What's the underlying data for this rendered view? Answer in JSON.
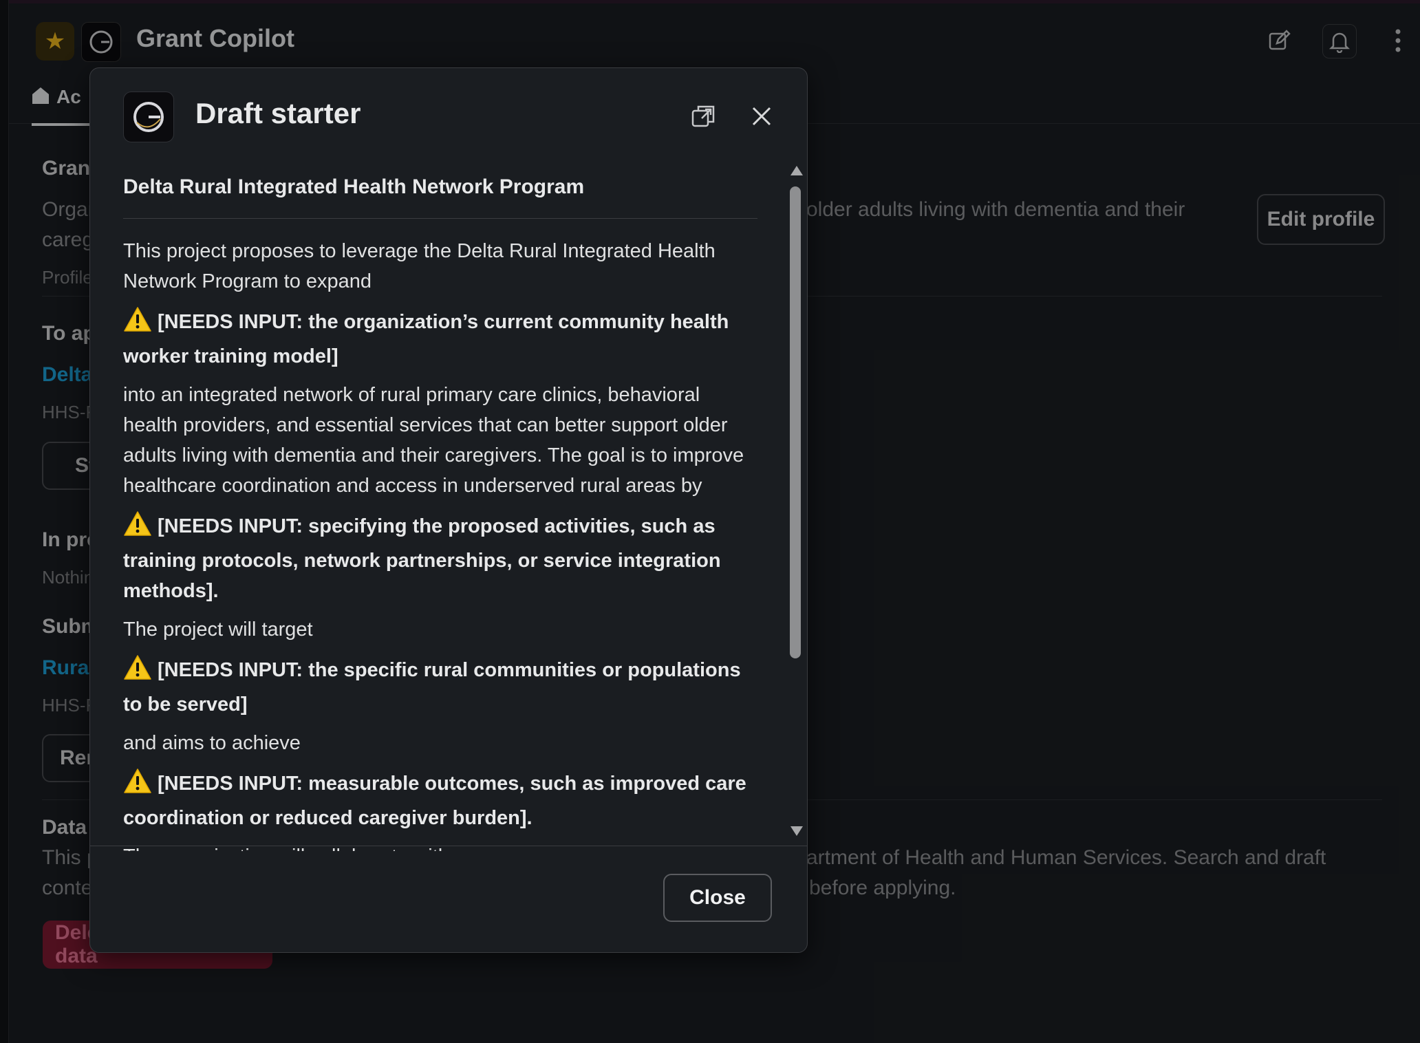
{
  "app": {
    "title": "Grant Copilot",
    "home_tab_label": "Ac"
  },
  "background": {
    "grant_heading": "Grant",
    "org_line1": "Organ",
    "org_line2": "careg",
    "org_right": "older adults living with dementia and their",
    "profile_label": "Profile",
    "edit_profile_label": "Edit profile",
    "to_apply_heading": "To ap",
    "delta_link": "Delta",
    "hhs_1": "HHS-F",
    "start_btn": "St",
    "in_progress_heading": "In pro",
    "nothing": "Nothin",
    "submitted_heading": "Subm",
    "rural_link": "Rural",
    "hhs_2": "HHS-F",
    "rem_btn": "Rer",
    "data_heading": "Data",
    "data_line1_left": "This p",
    "data_line1_right": "artment of Health and Human Services. Search and draft",
    "data_line2_left": "conte",
    "data_line2_right": "before applying.",
    "delete_btn": "Delete stored app data"
  },
  "modal": {
    "title": "Draft starter",
    "heading": "Delta Rural Integrated Health Network Program",
    "p1": "This project proposes to leverage the Delta Rural Integrated Health Network Program to expand",
    "n1": "[NEEDS INPUT: the organization’s current community health worker training model]",
    "p2": "into an integrated network of rural primary care clinics, behavioral health providers, and essential services that can better support older adults living with dementia and their caregivers. The goal is to improve healthcare coordination and access in underserved rural areas by",
    "n2": "[NEEDS INPUT: specifying the proposed activities, such as training protocols, network partnerships, or service integration methods].",
    "p3": "The project will target",
    "n3": "[NEEDS INPUT: the specific rural communities or populations to be served]",
    "p4": "and aims to achieve",
    "n4": "[NEEDS INPUT: measurable outcomes, such as improved care coordination or reduced caregiver burden].",
    "p5": "The organization will collaborate with",
    "close_button_label": "Close"
  },
  "colors": {
    "background": "#1a1d21",
    "link": "#1d9bd1",
    "warning": "#f5c518",
    "danger": "#7a1a30"
  }
}
